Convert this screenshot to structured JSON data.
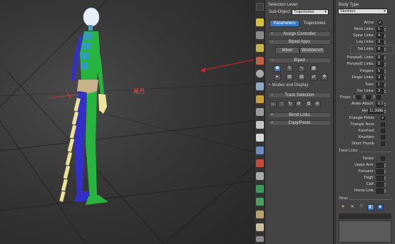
{
  "viewport": {
    "annotation_label": "尾巴"
  },
  "panel1": {
    "selection_level_label": "Selection Level:",
    "sub_object_label": "Sub-Object",
    "trajectories_dropdown": "Trajectories",
    "tabs": [
      "Parameters",
      "Trajectories"
    ],
    "rollouts": {
      "assign_controller": "Assign Controller",
      "biped_apps": "Biped Apps",
      "biped": "Biped",
      "track_selection": "Track Selection",
      "bend_links": "Bend Links",
      "copy_paste": "Copy/Paste"
    },
    "apps_buttons": [
      "Mixer",
      "Workbench"
    ],
    "modes_label": "Modes and Display"
  },
  "panel2": {
    "body_type_label": "Body Type",
    "body_type_value": "Skeleton",
    "rows": [
      {
        "label": "Arms:",
        "type": "check",
        "value": "✔"
      },
      {
        "label": "Neck Links:",
        "type": "field",
        "value": "1"
      },
      {
        "label": "Spine Links:",
        "type": "field",
        "value": "4"
      },
      {
        "label": "Leg Links:",
        "type": "field",
        "value": "3"
      },
      {
        "label": "Tail Links:",
        "type": "field",
        "value": "8"
      },
      {
        "label": "Ponytail1 Links:",
        "type": "field",
        "value": "0"
      },
      {
        "label": "Ponytail2 Links:",
        "type": "field",
        "value": "0"
      },
      {
        "label": "Fingers:",
        "type": "field",
        "value": "5"
      },
      {
        "label": "Finger Links:",
        "type": "field",
        "value": "3"
      },
      {
        "label": "Toes:",
        "type": "field",
        "value": "1"
      },
      {
        "label": "Toe Links:",
        "type": "field",
        "value": "3"
      }
    ],
    "props_label": "Props:",
    "props_values": [
      "1",
      "2",
      "3"
    ],
    "ankle_label": "Ankle Attach:",
    "ankle_value": "0.2",
    "height_label": "Height:",
    "height_value": "11.998b",
    "checks": [
      {
        "label": "Triangle Pelvis",
        "value": "✔"
      },
      {
        "label": "Triangle Neck",
        "value": ""
      },
      {
        "label": "ForeFeet",
        "value": ""
      },
      {
        "label": "Knuckles",
        "value": ""
      },
      {
        "label": "Short Thumb",
        "value": ""
      }
    ],
    "twist_header": "Twist Links",
    "twist_rows": [
      {
        "label": "Twists:"
      },
      {
        "label": "Upper Arm:"
      },
      {
        "label": "Forearm:"
      },
      {
        "label": "Thigh:"
      },
      {
        "label": "Calf:"
      },
      {
        "label": "Horse Link:"
      }
    ],
    "xtras_header": "Xtras"
  }
}
